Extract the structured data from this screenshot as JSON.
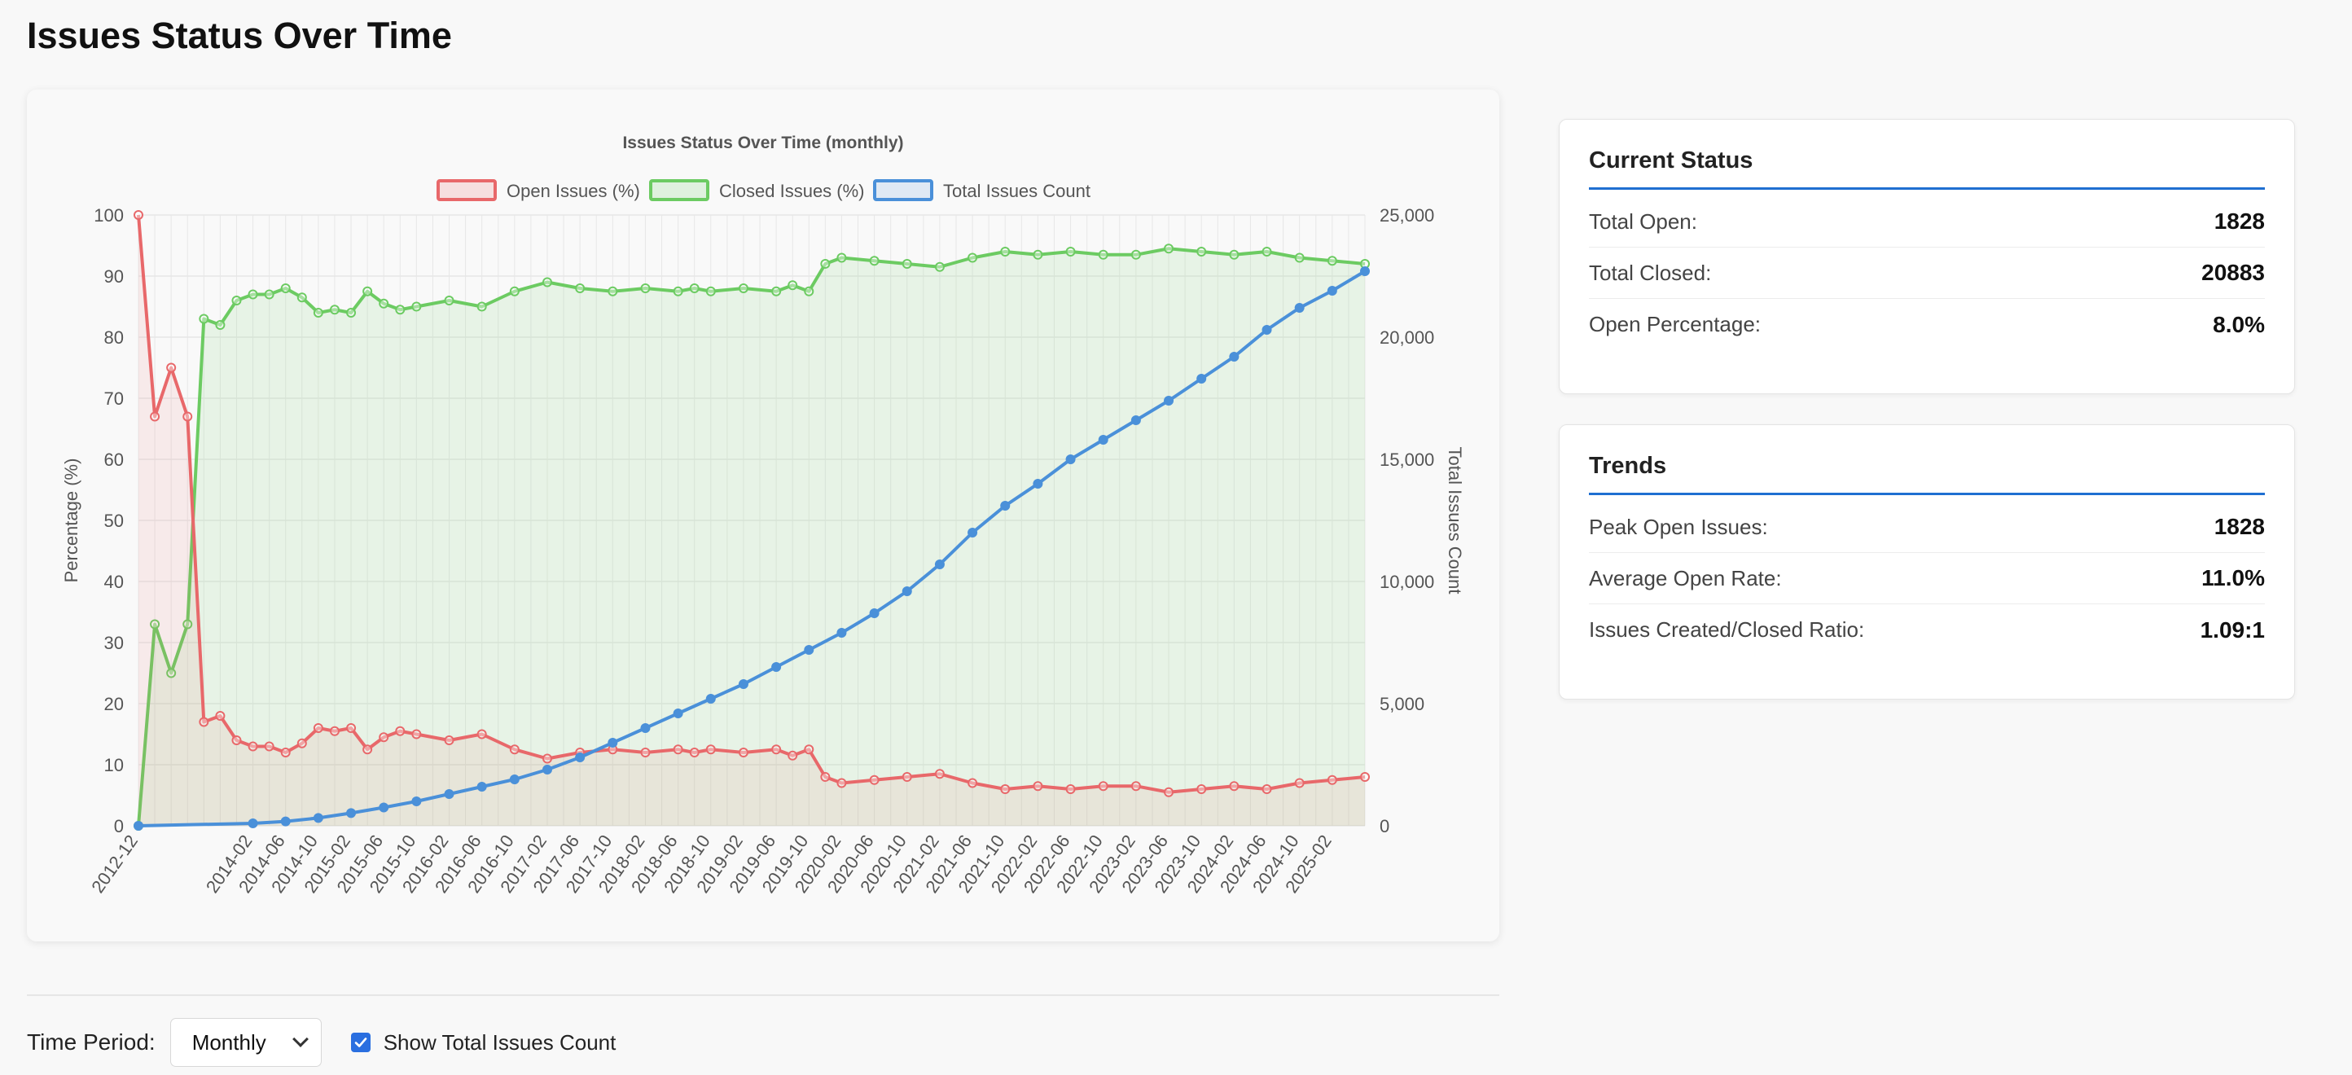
{
  "page": {
    "title": "Issues Status Over Time"
  },
  "chart_data": {
    "type": "line",
    "title": "Issues Status Over Time (monthly)",
    "legend": [
      "Open Issues (%)",
      "Closed Issues (%)",
      "Total Issues Count"
    ],
    "legend_placement": "top-center",
    "ylabel_left": "Percentage (%)",
    "ylabel_right": "Total Issues Count",
    "ylim_left": [
      0,
      100
    ],
    "ylim_right": [
      0,
      25000
    ],
    "y_ticks_left": [
      "0",
      "10",
      "20",
      "30",
      "40",
      "50",
      "60",
      "70",
      "80",
      "90",
      "100"
    ],
    "y_ticks_right": [
      "0",
      "5,000",
      "10,000",
      "15,000",
      "20,000",
      "25,000"
    ],
    "x_tick_labels": [
      "2012-12",
      "2014-02",
      "2014-06",
      "2014-10",
      "2015-02",
      "2015-06",
      "2015-10",
      "2016-02",
      "2016-06",
      "2016-10",
      "2017-02",
      "2017-06",
      "2017-10",
      "2018-02",
      "2018-06",
      "2018-10",
      "2019-02",
      "2019-06",
      "2019-10",
      "2020-02",
      "2020-06",
      "2020-10",
      "2021-02",
      "2021-06",
      "2021-10",
      "2022-02",
      "2022-06",
      "2022-10",
      "2023-02",
      "2023-06",
      "2023-10",
      "2024-02",
      "2024-06",
      "2024-10",
      "2025-02"
    ],
    "grid": true,
    "colors": {
      "open": "#e8686a",
      "closed": "#6ccb62",
      "total": "#4a90d9"
    },
    "series": [
      {
        "name": "Open Issues (%)",
        "points": [
          [
            "2012-12",
            100
          ],
          [
            "2013-02",
            67
          ],
          [
            "2013-04",
            75
          ],
          [
            "2013-06",
            67
          ],
          [
            "2013-08",
            17
          ],
          [
            "2013-10",
            18
          ],
          [
            "2013-12",
            14
          ],
          [
            "2014-02",
            13
          ],
          [
            "2014-04",
            13
          ],
          [
            "2014-06",
            12
          ],
          [
            "2014-08",
            13.5
          ],
          [
            "2014-10",
            16
          ],
          [
            "2014-12",
            15.5
          ],
          [
            "2015-02",
            16
          ],
          [
            "2015-04",
            12.5
          ],
          [
            "2015-06",
            14.5
          ],
          [
            "2015-08",
            15.5
          ],
          [
            "2015-10",
            15
          ],
          [
            "2016-02",
            14
          ],
          [
            "2016-06",
            15
          ],
          [
            "2016-10",
            12.5
          ],
          [
            "2017-02",
            11
          ],
          [
            "2017-06",
            12
          ],
          [
            "2017-10",
            12.5
          ],
          [
            "2018-02",
            12
          ],
          [
            "2018-06",
            12.5
          ],
          [
            "2018-08",
            12
          ],
          [
            "2018-10",
            12.5
          ],
          [
            "2019-02",
            12
          ],
          [
            "2019-06",
            12.5
          ],
          [
            "2019-08",
            11.5
          ],
          [
            "2019-10",
            12.5
          ],
          [
            "2019-12",
            8
          ],
          [
            "2020-02",
            7
          ],
          [
            "2020-06",
            7.5
          ],
          [
            "2020-10",
            8
          ],
          [
            "2021-02",
            8.5
          ],
          [
            "2021-06",
            7
          ],
          [
            "2021-10",
            6
          ],
          [
            "2022-02",
            6.5
          ],
          [
            "2022-06",
            6
          ],
          [
            "2022-10",
            6.5
          ],
          [
            "2023-02",
            6.5
          ],
          [
            "2023-06",
            5.5
          ],
          [
            "2023-10",
            6
          ],
          [
            "2024-02",
            6.5
          ],
          [
            "2024-06",
            6
          ],
          [
            "2024-10",
            7
          ],
          [
            "2025-02",
            7.5
          ],
          [
            "2025-06",
            8
          ]
        ]
      },
      {
        "name": "Closed Issues (%)",
        "points": [
          [
            "2012-12",
            0
          ],
          [
            "2013-02",
            33
          ],
          [
            "2013-04",
            25
          ],
          [
            "2013-06",
            33
          ],
          [
            "2013-08",
            83
          ],
          [
            "2013-10",
            82
          ],
          [
            "2013-12",
            86
          ],
          [
            "2014-02",
            87
          ],
          [
            "2014-04",
            87
          ],
          [
            "2014-06",
            88
          ],
          [
            "2014-08",
            86.5
          ],
          [
            "2014-10",
            84
          ],
          [
            "2014-12",
            84.5
          ],
          [
            "2015-02",
            84
          ],
          [
            "2015-04",
            87.5
          ],
          [
            "2015-06",
            85.5
          ],
          [
            "2015-08",
            84.5
          ],
          [
            "2015-10",
            85
          ],
          [
            "2016-02",
            86
          ],
          [
            "2016-06",
            85
          ],
          [
            "2016-10",
            87.5
          ],
          [
            "2017-02",
            89
          ],
          [
            "2017-06",
            88
          ],
          [
            "2017-10",
            87.5
          ],
          [
            "2018-02",
            88
          ],
          [
            "2018-06",
            87.5
          ],
          [
            "2018-08",
            88
          ],
          [
            "2018-10",
            87.5
          ],
          [
            "2019-02",
            88
          ],
          [
            "2019-06",
            87.5
          ],
          [
            "2019-08",
            88.5
          ],
          [
            "2019-10",
            87.5
          ],
          [
            "2019-12",
            92
          ],
          [
            "2020-02",
            93
          ],
          [
            "2020-06",
            92.5
          ],
          [
            "2020-10",
            92
          ],
          [
            "2021-02",
            91.5
          ],
          [
            "2021-06",
            93
          ],
          [
            "2021-10",
            94
          ],
          [
            "2022-02",
            93.5
          ],
          [
            "2022-06",
            94
          ],
          [
            "2022-10",
            93.5
          ],
          [
            "2023-02",
            93.5
          ],
          [
            "2023-06",
            94.5
          ],
          [
            "2023-10",
            94
          ],
          [
            "2024-02",
            93.5
          ],
          [
            "2024-06",
            94
          ],
          [
            "2024-10",
            93
          ],
          [
            "2025-02",
            92.5
          ],
          [
            "2025-06",
            92
          ]
        ]
      },
      {
        "name": "Total Issues Count",
        "points": [
          [
            "2012-12",
            0
          ],
          [
            "2014-02",
            100
          ],
          [
            "2014-06",
            180
          ],
          [
            "2014-10",
            320
          ],
          [
            "2015-02",
            520
          ],
          [
            "2015-06",
            750
          ],
          [
            "2015-10",
            1000
          ],
          [
            "2016-02",
            1300
          ],
          [
            "2016-06",
            1600
          ],
          [
            "2016-10",
            1900
          ],
          [
            "2017-02",
            2300
          ],
          [
            "2017-06",
            2800
          ],
          [
            "2017-10",
            3400
          ],
          [
            "2018-02",
            4000
          ],
          [
            "2018-06",
            4600
          ],
          [
            "2018-10",
            5200
          ],
          [
            "2019-02",
            5800
          ],
          [
            "2019-06",
            6500
          ],
          [
            "2019-10",
            7200
          ],
          [
            "2020-02",
            7900
          ],
          [
            "2020-06",
            8700
          ],
          [
            "2020-10",
            9600
          ],
          [
            "2021-02",
            10700
          ],
          [
            "2021-06",
            12000
          ],
          [
            "2021-10",
            13100
          ],
          [
            "2022-02",
            14000
          ],
          [
            "2022-06",
            15000
          ],
          [
            "2022-10",
            15800
          ],
          [
            "2023-02",
            16600
          ],
          [
            "2023-06",
            17400
          ],
          [
            "2023-10",
            18300
          ],
          [
            "2024-02",
            19200
          ],
          [
            "2024-06",
            20300
          ],
          [
            "2024-10",
            21200
          ],
          [
            "2025-02",
            21900
          ],
          [
            "2025-06",
            22700
          ]
        ]
      }
    ]
  },
  "current_status": {
    "title": "Current Status",
    "rows": [
      {
        "label": "Total Open:",
        "value": "1828"
      },
      {
        "label": "Total Closed:",
        "value": "20883"
      },
      {
        "label": "Open Percentage:",
        "value": "8.0%"
      }
    ]
  },
  "trends": {
    "title": "Trends",
    "rows": [
      {
        "label": "Peak Open Issues:",
        "value": "1828"
      },
      {
        "label": "Average Open Rate:",
        "value": "11.0%"
      },
      {
        "label": "Issues Created/Closed Ratio:",
        "value": "1.09:1"
      }
    ]
  },
  "controls": {
    "time_period_label": "Time Period:",
    "time_period_value": "Monthly",
    "show_total_label": "Show Total Issues Count",
    "show_total_checked": true
  }
}
